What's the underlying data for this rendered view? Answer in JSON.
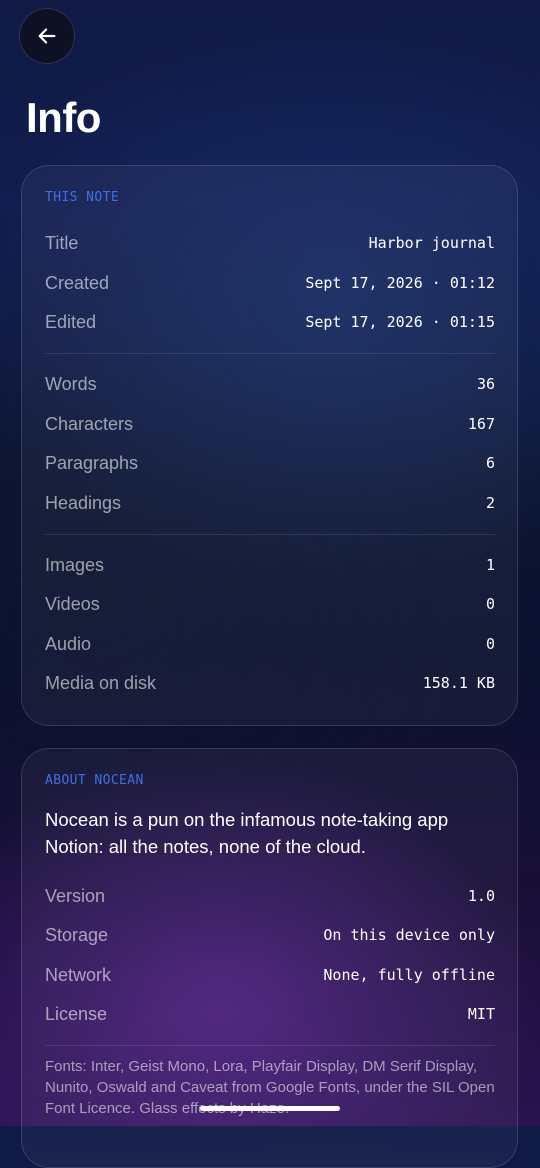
{
  "header": {
    "back_icon": "arrow-left-icon",
    "title": "Info"
  },
  "note_section": {
    "label": "THIS NOTE",
    "groups": [
      [
        {
          "label": "Title",
          "value": "Harbor journal"
        },
        {
          "label": "Created",
          "value": "Sept 17, 2026 · 01:12"
        },
        {
          "label": "Edited",
          "value": "Sept 17, 2026 · 01:15"
        }
      ],
      [
        {
          "label": "Words",
          "value": "36"
        },
        {
          "label": "Characters",
          "value": "167"
        },
        {
          "label": "Paragraphs",
          "value": "6"
        },
        {
          "label": "Headings",
          "value": "2"
        }
      ],
      [
        {
          "label": "Images",
          "value": "1"
        },
        {
          "label": "Videos",
          "value": "0"
        },
        {
          "label": "Audio",
          "value": "0"
        },
        {
          "label": "Media on disk",
          "value": "158.1 KB"
        }
      ]
    ]
  },
  "about_section": {
    "label": "ABOUT NOCEAN",
    "description": "Nocean is a pun on the infamous note-taking app Notion: all the notes, none of the cloud.",
    "rows": [
      {
        "label": "Version",
        "value": "1.0"
      },
      {
        "label": "Storage",
        "value": "On this device only"
      },
      {
        "label": "Network",
        "value": "None, fully offline"
      },
      {
        "label": "License",
        "value": "MIT"
      }
    ],
    "fonts_note": "Fonts: Inter, Geist Mono, Lora, Playfair Display, DM Serif Display, Nunito, Oswald and Caveat from Google Fonts, under the SIL Open Font Licence. Glass effects by Haze."
  },
  "colors": {
    "accent": "#3f6fe6",
    "background_top": "#121c4e",
    "background_bottom": "#2a1350"
  }
}
